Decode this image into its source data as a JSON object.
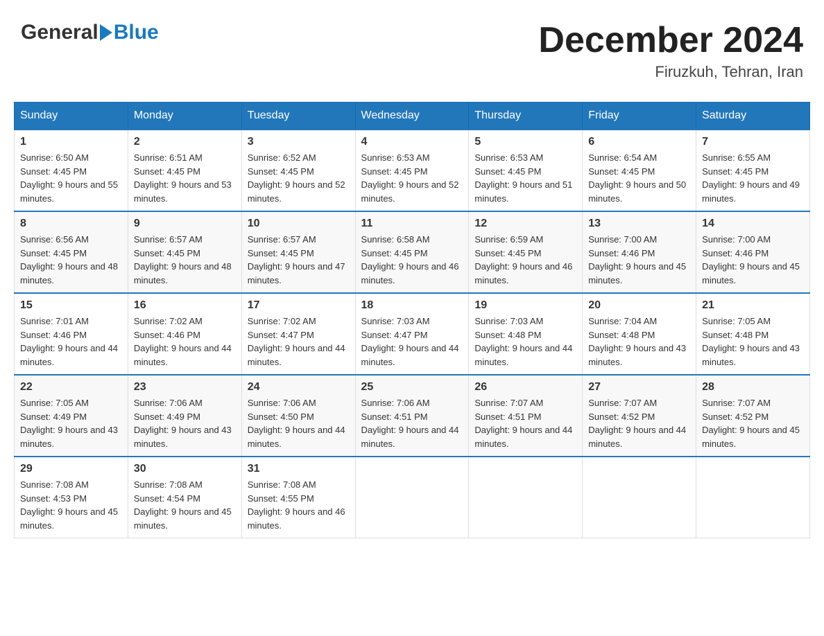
{
  "header": {
    "logo": {
      "general": "General",
      "blue": "Blue"
    },
    "title": "December 2024",
    "location": "Firuzkuh, Tehran, Iran"
  },
  "calendar": {
    "days": [
      "Sunday",
      "Monday",
      "Tuesday",
      "Wednesday",
      "Thursday",
      "Friday",
      "Saturday"
    ],
    "weeks": [
      [
        {
          "date": "1",
          "sunrise": "6:50 AM",
          "sunset": "4:45 PM",
          "daylight": "9 hours and 55 minutes."
        },
        {
          "date": "2",
          "sunrise": "6:51 AM",
          "sunset": "4:45 PM",
          "daylight": "9 hours and 53 minutes."
        },
        {
          "date": "3",
          "sunrise": "6:52 AM",
          "sunset": "4:45 PM",
          "daylight": "9 hours and 52 minutes."
        },
        {
          "date": "4",
          "sunrise": "6:53 AM",
          "sunset": "4:45 PM",
          "daylight": "9 hours and 52 minutes."
        },
        {
          "date": "5",
          "sunrise": "6:53 AM",
          "sunset": "4:45 PM",
          "daylight": "9 hours and 51 minutes."
        },
        {
          "date": "6",
          "sunrise": "6:54 AM",
          "sunset": "4:45 PM",
          "daylight": "9 hours and 50 minutes."
        },
        {
          "date": "7",
          "sunrise": "6:55 AM",
          "sunset": "4:45 PM",
          "daylight": "9 hours and 49 minutes."
        }
      ],
      [
        {
          "date": "8",
          "sunrise": "6:56 AM",
          "sunset": "4:45 PM",
          "daylight": "9 hours and 48 minutes."
        },
        {
          "date": "9",
          "sunrise": "6:57 AM",
          "sunset": "4:45 PM",
          "daylight": "9 hours and 48 minutes."
        },
        {
          "date": "10",
          "sunrise": "6:57 AM",
          "sunset": "4:45 PM",
          "daylight": "9 hours and 47 minutes."
        },
        {
          "date": "11",
          "sunrise": "6:58 AM",
          "sunset": "4:45 PM",
          "daylight": "9 hours and 46 minutes."
        },
        {
          "date": "12",
          "sunrise": "6:59 AM",
          "sunset": "4:45 PM",
          "daylight": "9 hours and 46 minutes."
        },
        {
          "date": "13",
          "sunrise": "7:00 AM",
          "sunset": "4:46 PM",
          "daylight": "9 hours and 45 minutes."
        },
        {
          "date": "14",
          "sunrise": "7:00 AM",
          "sunset": "4:46 PM",
          "daylight": "9 hours and 45 minutes."
        }
      ],
      [
        {
          "date": "15",
          "sunrise": "7:01 AM",
          "sunset": "4:46 PM",
          "daylight": "9 hours and 44 minutes."
        },
        {
          "date": "16",
          "sunrise": "7:02 AM",
          "sunset": "4:46 PM",
          "daylight": "9 hours and 44 minutes."
        },
        {
          "date": "17",
          "sunrise": "7:02 AM",
          "sunset": "4:47 PM",
          "daylight": "9 hours and 44 minutes."
        },
        {
          "date": "18",
          "sunrise": "7:03 AM",
          "sunset": "4:47 PM",
          "daylight": "9 hours and 44 minutes."
        },
        {
          "date": "19",
          "sunrise": "7:03 AM",
          "sunset": "4:48 PM",
          "daylight": "9 hours and 44 minutes."
        },
        {
          "date": "20",
          "sunrise": "7:04 AM",
          "sunset": "4:48 PM",
          "daylight": "9 hours and 43 minutes."
        },
        {
          "date": "21",
          "sunrise": "7:05 AM",
          "sunset": "4:48 PM",
          "daylight": "9 hours and 43 minutes."
        }
      ],
      [
        {
          "date": "22",
          "sunrise": "7:05 AM",
          "sunset": "4:49 PM",
          "daylight": "9 hours and 43 minutes."
        },
        {
          "date": "23",
          "sunrise": "7:06 AM",
          "sunset": "4:49 PM",
          "daylight": "9 hours and 43 minutes."
        },
        {
          "date": "24",
          "sunrise": "7:06 AM",
          "sunset": "4:50 PM",
          "daylight": "9 hours and 44 minutes."
        },
        {
          "date": "25",
          "sunrise": "7:06 AM",
          "sunset": "4:51 PM",
          "daylight": "9 hours and 44 minutes."
        },
        {
          "date": "26",
          "sunrise": "7:07 AM",
          "sunset": "4:51 PM",
          "daylight": "9 hours and 44 minutes."
        },
        {
          "date": "27",
          "sunrise": "7:07 AM",
          "sunset": "4:52 PM",
          "daylight": "9 hours and 44 minutes."
        },
        {
          "date": "28",
          "sunrise": "7:07 AM",
          "sunset": "4:52 PM",
          "daylight": "9 hours and 45 minutes."
        }
      ],
      [
        {
          "date": "29",
          "sunrise": "7:08 AM",
          "sunset": "4:53 PM",
          "daylight": "9 hours and 45 minutes."
        },
        {
          "date": "30",
          "sunrise": "7:08 AM",
          "sunset": "4:54 PM",
          "daylight": "9 hours and 45 minutes."
        },
        {
          "date": "31",
          "sunrise": "7:08 AM",
          "sunset": "4:55 PM",
          "daylight": "9 hours and 46 minutes."
        },
        null,
        null,
        null,
        null
      ]
    ]
  },
  "labels": {
    "sunrise": "Sunrise:",
    "sunset": "Sunset:",
    "daylight": "Daylight:"
  }
}
